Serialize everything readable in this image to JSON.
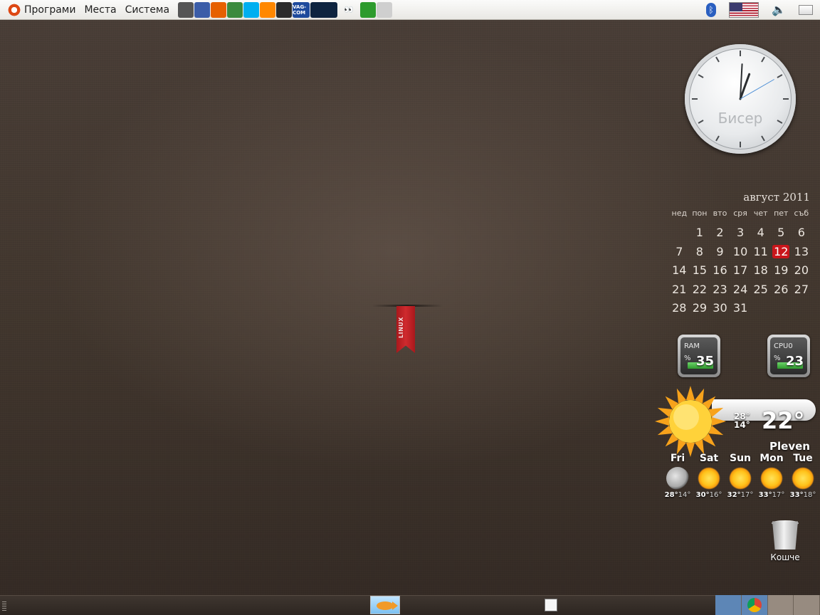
{
  "top_panel": {
    "menus": [
      "Програми",
      "Места",
      "Система"
    ],
    "launchers": [
      {
        "name": "screenshot-icon",
        "color": "#555"
      },
      {
        "name": "gimp-icon",
        "color": "#3b5da8"
      },
      {
        "name": "firefox-icon",
        "color": "#e66000"
      },
      {
        "name": "chrome-icon",
        "color": "#3b8a3e"
      },
      {
        "name": "skype-icon",
        "color": "#00aff0"
      },
      {
        "name": "vlc-icon",
        "color": "#ff8800"
      },
      {
        "name": "terminal-icon",
        "color": "#2b2b2b"
      },
      {
        "name": "vag-com-icon",
        "color": "#1e4a9c"
      },
      {
        "name": "system-monitor-icon",
        "color": "#0e2440"
      },
      {
        "name": "xeyes-icon",
        "color": "#dcdcdc"
      },
      {
        "name": "exit-icon",
        "color": "#2d9b2d"
      },
      {
        "name": "phone-icon",
        "color": "#cfcfcf"
      }
    ],
    "vag_label": "VAG-COM",
    "tray": [
      "bluetooth-icon",
      "us-flag-icon",
      "volume-icon",
      "mail-icon"
    ]
  },
  "clock": {
    "label": "Бисер",
    "hour_angle": 20,
    "minute_angle": 3,
    "second_angle": 60
  },
  "calendar": {
    "title": "август 2011",
    "weekdays": [
      "нед",
      "пон",
      "вто",
      "сря",
      "чет",
      "пет",
      "съб"
    ],
    "leading_blanks": 1,
    "days": [
      "1",
      "2",
      "3",
      "4",
      "5",
      "6",
      "7",
      "8",
      "9",
      "10",
      "11",
      "12",
      "13",
      "14",
      "15",
      "16",
      "17",
      "18",
      "19",
      "20",
      "21",
      "22",
      "23",
      "24",
      "25",
      "26",
      "27",
      "28",
      "29",
      "30",
      "31"
    ],
    "today": "12"
  },
  "meters": {
    "ram": {
      "label": "RAM",
      "unit": "%",
      "value": "35"
    },
    "cpu": {
      "label": "CPU0",
      "unit": "%",
      "value": "23"
    }
  },
  "weather": {
    "high": "28°",
    "low": "14°",
    "current_temp": "22°",
    "city": "Pleven",
    "forecast": [
      {
        "day": "Fri",
        "hi": "28°",
        "lo": "14°",
        "icon": "moon"
      },
      {
        "day": "Sat",
        "hi": "30°",
        "lo": "16°",
        "icon": "sun"
      },
      {
        "day": "Sun",
        "hi": "32°",
        "lo": "17°",
        "icon": "sun"
      },
      {
        "day": "Mon",
        "hi": "33°",
        "lo": "17°",
        "icon": "sun"
      },
      {
        "day": "Tue",
        "hi": "33°",
        "lo": "18°",
        "icon": "sun"
      }
    ]
  },
  "ribbon": {
    "text": "LINUX"
  },
  "trash": {
    "label": "Кошче"
  }
}
